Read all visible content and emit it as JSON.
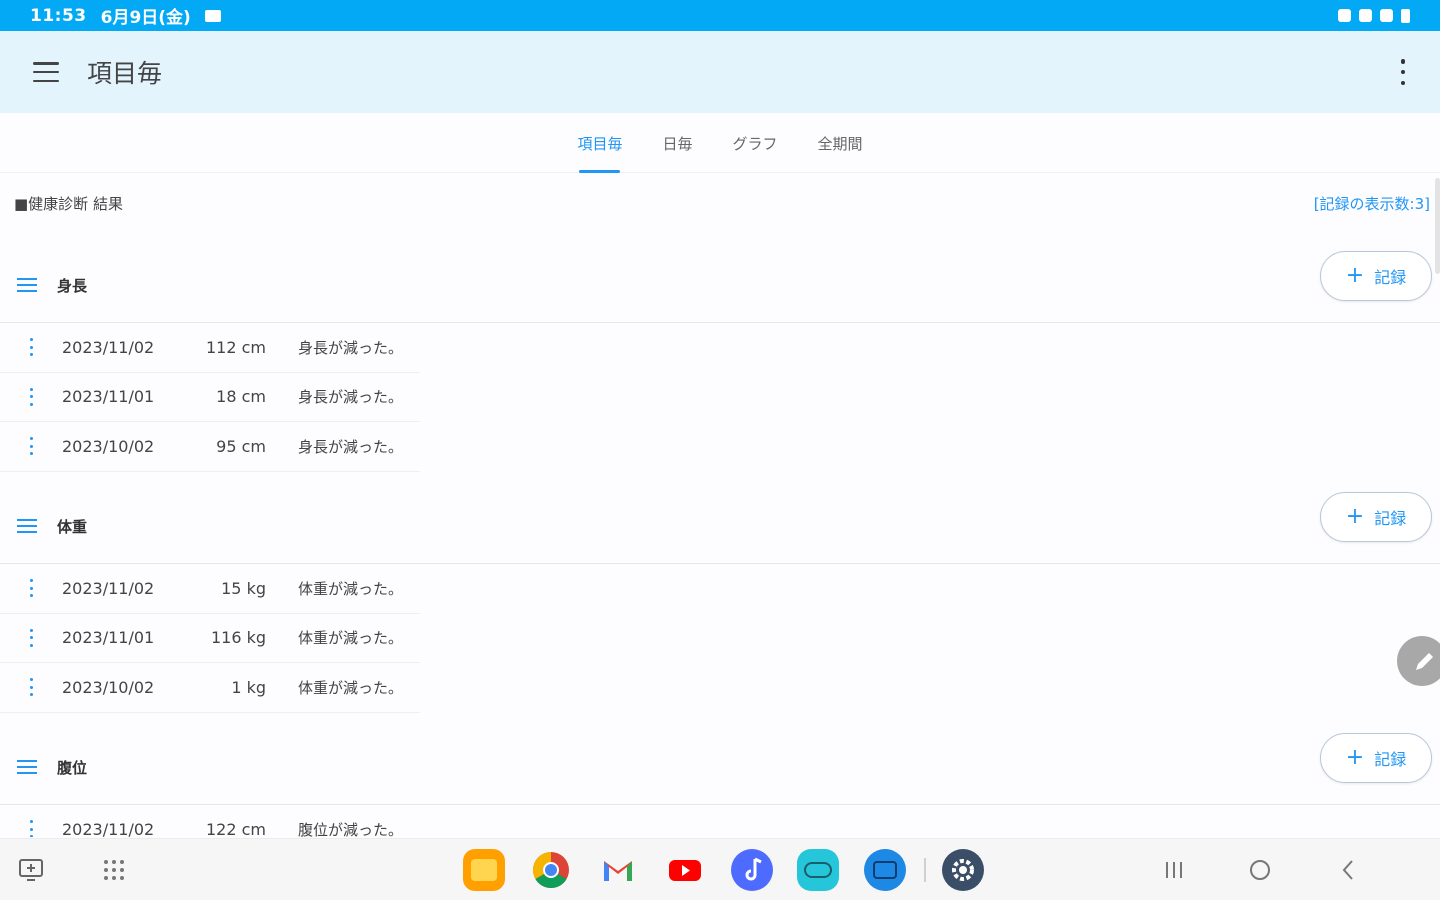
{
  "status_bar": {
    "time": "11:53",
    "date": "6月9日(金)"
  },
  "app_bar": {
    "title": "項目毎"
  },
  "tabs": [
    {
      "label": "項目毎",
      "active": true
    },
    {
      "label": "日毎",
      "active": false
    },
    {
      "label": "グラフ",
      "active": false
    },
    {
      "label": "全期間",
      "active": false
    }
  ],
  "section": {
    "title": "■健康診断 結果",
    "record_count": "[記録の表示数:3]"
  },
  "add_button_label": "記録",
  "groups": [
    {
      "name": "身長",
      "rows": [
        {
          "date": "2023/11/02",
          "value": "112 cm",
          "note": "身長が減った。"
        },
        {
          "date": "2023/11/01",
          "value": "18 cm",
          "note": "身長が減った。"
        },
        {
          "date": "2023/10/02",
          "value": "95 cm",
          "note": "身長が減った。"
        }
      ]
    },
    {
      "name": "体重",
      "rows": [
        {
          "date": "2023/11/02",
          "value": "15 kg",
          "note": "体重が減った。"
        },
        {
          "date": "2023/11/01",
          "value": "116 kg",
          "note": "体重が減った。"
        },
        {
          "date": "2023/10/02",
          "value": "1 kg",
          "note": "体重が減った。"
        }
      ]
    },
    {
      "name": "腹位",
      "rows": [
        {
          "date": "2023/11/02",
          "value": "122 cm",
          "note": "腹位が減った。"
        }
      ]
    }
  ],
  "colors": {
    "accent": "#2196f3",
    "status_bar": "#03a9f4",
    "app_bar": "#e4f4fd"
  },
  "dock_apps": [
    "files-icon",
    "chrome-icon",
    "gmail-icon",
    "youtube-icon",
    "music-icon",
    "gamepad-icon",
    "video-icon",
    "settings-icon"
  ]
}
